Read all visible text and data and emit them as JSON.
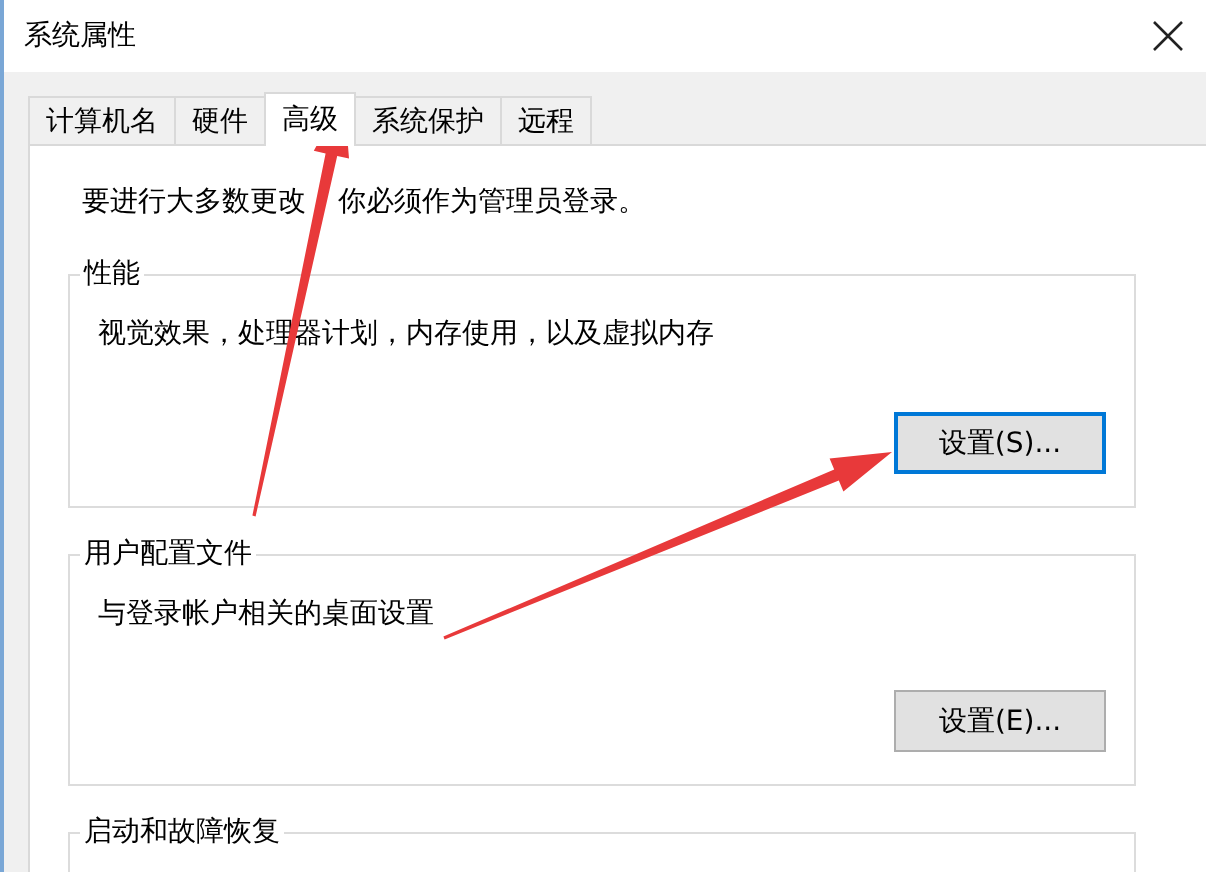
{
  "window": {
    "title": "系统属性"
  },
  "tabs": [
    {
      "label": "计算机名",
      "selected": false
    },
    {
      "label": "硬件",
      "selected": false
    },
    {
      "label": "高级",
      "selected": true
    },
    {
      "label": "系统保护",
      "selected": false
    },
    {
      "label": "远程",
      "selected": false
    }
  ],
  "notice": [
    "要进行大多数更改",
    "你必须作为管理员登录。"
  ],
  "groups": [
    {
      "title": "性能",
      "description": "视觉效果，处理器计划，内存使用，以及虚拟内存",
      "button": {
        "label": "设置(S)...",
        "focused": true
      }
    },
    {
      "title": "用户配置文件",
      "description": "与登录帐户相关的桌面设置",
      "button": {
        "label": "设置(E)...",
        "focused": false
      }
    },
    {
      "title": "启动和故障恢复"
    }
  ]
}
